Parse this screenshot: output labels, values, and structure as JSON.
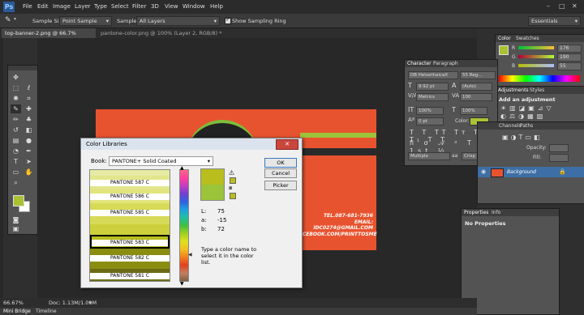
{
  "menu": {
    "app_icon": "Ps",
    "items": [
      "File",
      "Edit",
      "Image",
      "Layer",
      "Type",
      "Select",
      "Filter",
      "3D",
      "View",
      "Window",
      "Help"
    ]
  },
  "options": {
    "sample_size_label": "Sample Size:",
    "sample_size_value": "Point Sample",
    "sample_label": "Sample:",
    "sample_value": "All Layers",
    "show_ring_label": "Show Sampling Ring",
    "workspace": "Essentials"
  },
  "tabs": [
    {
      "label": "top-banner-2.png @ 66.7% (RGB/8)",
      "close": "×"
    },
    {
      "label": "pantone-color.png @ 100% (Layer 2, RGB/8) *",
      "close": "×"
    }
  ],
  "canvas": {
    "text_lines": [
      "TEL.087-681-7936",
      "EMAIL: IDC0274@GMAIL.COM",
      "FACEBOOK.COM/PRINTTOSME"
    ]
  },
  "dialog": {
    "title": "Color Libraries",
    "close": "✕",
    "book_label": "Book:",
    "book_value": "PANTONE+ Solid Coated",
    "swatches": [
      {
        "name": "",
        "color": "#e6eaa3"
      },
      {
        "name": "PANTONE 587 C",
        "color": "#e1e68c"
      },
      {
        "name": "PANTONE 586 C",
        "color": "#e2e57e"
      },
      {
        "name": "PANTONE 585 C",
        "color": "#d7da56"
      },
      {
        "name": "PANTONE 584 C",
        "color": "#cdd03d"
      },
      {
        "name": "PANTONE 583 C",
        "color": "#b9be1e"
      },
      {
        "name": "PANTONE 582 C",
        "color": "#8a8d10"
      },
      {
        "name": "PANTONE 581 C",
        "color": "#6b6a16"
      }
    ],
    "selected_index": 5,
    "preview_new": "#b9be1e",
    "preview_old": "#9bc43a",
    "lab": [
      {
        "label": "L:",
        "value": "75"
      },
      {
        "label": "a:",
        "value": "-15"
      },
      {
        "label": "b:",
        "value": "72"
      }
    ],
    "hint": "Type a color name to select it in the color list.",
    "buttons": {
      "ok": "OK",
      "cancel": "Cancel",
      "picker": "Picker"
    }
  },
  "color_panel": {
    "tabs": [
      "Color",
      "Swatches"
    ],
    "rows": [
      {
        "label": "R",
        "value": "176"
      },
      {
        "label": "G",
        "value": "190"
      },
      {
        "label": "B",
        "value": "55"
      }
    ],
    "foreground": "#a9c234"
  },
  "character_panel": {
    "tabs": [
      "Character",
      "Paragraph"
    ],
    "font": "DB HelvethaicaX",
    "style": "55 Reg...",
    "size": "9.92 pt",
    "leading": "(Auto)",
    "kerning": "Metrics",
    "tracking": "100",
    "scale_v": "100%",
    "scale_h": "100%",
    "baseline": "0 pt",
    "color_label": "Color:",
    "color": "#a9c234",
    "lang": "Multiple",
    "aa": "Crisp",
    "aa_prefix": "aa"
  },
  "adjustments_panel": {
    "tabs": [
      "Adjustments",
      "Styles"
    ],
    "heading": "Add an adjustment"
  },
  "layers_panel": {
    "tabs": [
      "Channels",
      "Paths"
    ],
    "opacity_label": "Opacity:",
    "fill_label": "Fill:",
    "layer_name": "Background"
  },
  "properties_panel": {
    "tabs": [
      "Properties",
      "Info"
    ],
    "text": "No Properties"
  },
  "status": {
    "zoom": "66.67%",
    "doc": "Doc: 1.13M/1.09M"
  },
  "bottom_tabs": [
    "Mini Bridge",
    "Timeline"
  ]
}
